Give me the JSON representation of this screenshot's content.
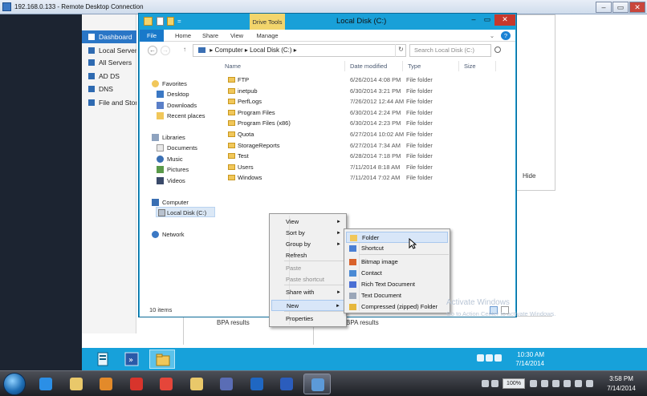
{
  "rdp": {
    "title": "192.168.0.133 - Remote Desktop Connection",
    "minimize": "–",
    "restore": "▭",
    "close": "✕"
  },
  "server_manager": {
    "sidebar": [
      {
        "label": "Dashboard",
        "active": true
      },
      {
        "label": "Local Server",
        "active": false
      },
      {
        "label": "All Servers",
        "active": false
      },
      {
        "label": "AD DS",
        "active": false
      },
      {
        "label": "DNS",
        "active": false
      },
      {
        "label": "File and Storage Services",
        "active": false
      }
    ],
    "hide_label": "Hide",
    "bpa_left": "BPA results",
    "bpa_right": "BPA results"
  },
  "explorer": {
    "title": "Local Disk (C:)",
    "drive_tools": "Drive Tools",
    "qat_arrow": "=",
    "tabs": [
      "File",
      "Home",
      "Share",
      "View",
      "Manage"
    ],
    "nav_back": "←",
    "nav_forward": "→",
    "nav_up": "↑",
    "address": [
      "Computer",
      "Local Disk (C:)"
    ],
    "addr_sep": "▸",
    "refresh": "↻",
    "search_placeholder": "Search Local Disk (C:)",
    "help": "?",
    "columns": [
      "Name",
      "Date modified",
      "Type",
      "Size"
    ],
    "nav_pane": {
      "favorites": "Favorites",
      "favorites_items": [
        "Desktop",
        "Downloads",
        "Recent places"
      ],
      "libraries": "Libraries",
      "libraries_items": [
        "Documents",
        "Music",
        "Pictures",
        "Videos"
      ],
      "computer": "Computer",
      "computer_items": [
        "Local Disk (C:)"
      ],
      "network": "Network"
    },
    "files": [
      {
        "name": "FTP",
        "date": "6/26/2014 4:08 PM",
        "type": "File folder"
      },
      {
        "name": "inetpub",
        "date": "6/30/2014 3:21 PM",
        "type": "File folder"
      },
      {
        "name": "PerfLogs",
        "date": "7/26/2012 12:44 AM",
        "type": "File folder"
      },
      {
        "name": "Program Files",
        "date": "6/30/2014 2:24 PM",
        "type": "File folder"
      },
      {
        "name": "Program Files (x86)",
        "date": "6/30/2014 2:23 PM",
        "type": "File folder"
      },
      {
        "name": "Quota",
        "date": "6/27/2014 10:02 AM",
        "type": "File folder"
      },
      {
        "name": "StorageReports",
        "date": "6/27/2014 7:34 AM",
        "type": "File folder"
      },
      {
        "name": "Test",
        "date": "6/28/2014 7:18 PM",
        "type": "File folder"
      },
      {
        "name": "Users",
        "date": "7/11/2014 8:18 AM",
        "type": "File folder"
      },
      {
        "name": "Windows",
        "date": "7/11/2014 7:02 AM",
        "type": "File folder"
      }
    ],
    "status": "10 items"
  },
  "context_menu": {
    "items": [
      {
        "label": "View",
        "submenu": true,
        "disabled": false
      },
      {
        "label": "Sort by",
        "submenu": true,
        "disabled": false
      },
      {
        "label": "Group by",
        "submenu": true,
        "disabled": false
      },
      {
        "label": "Refresh",
        "submenu": false,
        "disabled": false
      },
      {
        "label": "Paste",
        "submenu": false,
        "disabled": true
      },
      {
        "label": "Paste shortcut",
        "submenu": false,
        "disabled": true
      },
      {
        "label": "Share with",
        "submenu": true,
        "disabled": false
      },
      {
        "label": "New",
        "submenu": true,
        "disabled": false,
        "highlighted": true
      },
      {
        "label": "Properties",
        "submenu": false,
        "disabled": false
      }
    ],
    "arrow": "►"
  },
  "new_submenu": {
    "items": [
      {
        "label": "Folder",
        "icon": "folder-icon",
        "color": "#f1c75a",
        "highlighted": true
      },
      {
        "label": "Shortcut",
        "icon": "shortcut-icon",
        "color": "#4a7fd4"
      },
      {
        "label": "Bitmap image",
        "icon": "bitmap-icon",
        "color": "#d9622b"
      },
      {
        "label": "Contact",
        "icon": "contact-icon",
        "color": "#4a8ad4"
      },
      {
        "label": "Rich Text Document",
        "icon": "rtf-icon",
        "color": "#4a6fd4"
      },
      {
        "label": "Text Document",
        "icon": "text-icon",
        "color": "#9aa6b8"
      },
      {
        "label": "Compressed (zipped) Folder",
        "icon": "zip-folder-icon",
        "color": "#e6b73c"
      }
    ]
  },
  "watermark": {
    "line1": "Activate Windows",
    "line2": "Go to Action Center to activate Windows."
  },
  "inner_taskbar": {
    "time": "10:30 AM",
    "date": "7/14/2014"
  },
  "host_taskbar": {
    "battery": "100%",
    "time": "3:58 PM",
    "date": "7/14/2014",
    "apps": [
      {
        "name": "ie-icon",
        "color": "#2b8fe6",
        "active": false
      },
      {
        "name": "explorer-icon",
        "color": "#e9c86a",
        "active": false
      },
      {
        "name": "media-player-icon",
        "color": "#e38a2a",
        "active": false
      },
      {
        "name": "app-red-icon",
        "color": "#d8342c",
        "active": false
      },
      {
        "name": "chrome-icon",
        "color": "#e5463a",
        "active": false
      },
      {
        "name": "folder-app-icon",
        "color": "#e9c86a",
        "active": false
      },
      {
        "name": "photos-icon",
        "color": "#5a6db5",
        "active": false
      },
      {
        "name": "outlook-icon",
        "color": "#1f67c2",
        "active": false
      },
      {
        "name": "word-icon",
        "color": "#2b5dbd",
        "active": false
      },
      {
        "name": "rdp-icon",
        "color": "#5c9ad8",
        "active": true
      }
    ]
  },
  "colors": {
    "server_accent": "#17a1da",
    "selection": "#d8e6f8",
    "sidebar_active": "#2a76c6"
  }
}
